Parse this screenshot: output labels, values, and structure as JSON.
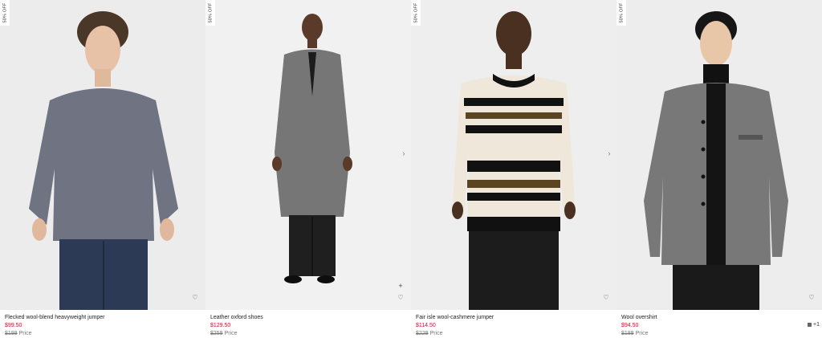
{
  "products": [
    {
      "badge": "50% OFF",
      "name": "Flecked wool-blend heavyweight jumper",
      "sale_price": "$99.50",
      "original_price": "$199",
      "price_label": "Price",
      "icons": [
        "heart-icon"
      ]
    },
    {
      "badge": "50% OFF",
      "name": "Leather oxford shoes",
      "sale_price": "$129.50",
      "original_price": "$259",
      "price_label": "Price",
      "icons": [
        "plus-icon",
        "heart-icon",
        "chevron-right-icon"
      ]
    },
    {
      "badge": "50% OFF",
      "name": "Fair isle wool-cashmere jumper",
      "sale_price": "$114.50",
      "original_price": "$229",
      "price_label": "Price",
      "icons": [
        "heart-icon",
        "chevron-right-icon"
      ]
    },
    {
      "badge": "50% OFF",
      "name": "Wool overshirt",
      "sale_price": "$94.50",
      "original_price": "$189",
      "price_label": "Price",
      "extra_colors": "+1",
      "icons": [
        "heart-icon",
        "color-swatch"
      ]
    }
  ],
  "colors": {
    "sale": "#c8102e",
    "muted": "#777777",
    "swatch": "#666666"
  }
}
